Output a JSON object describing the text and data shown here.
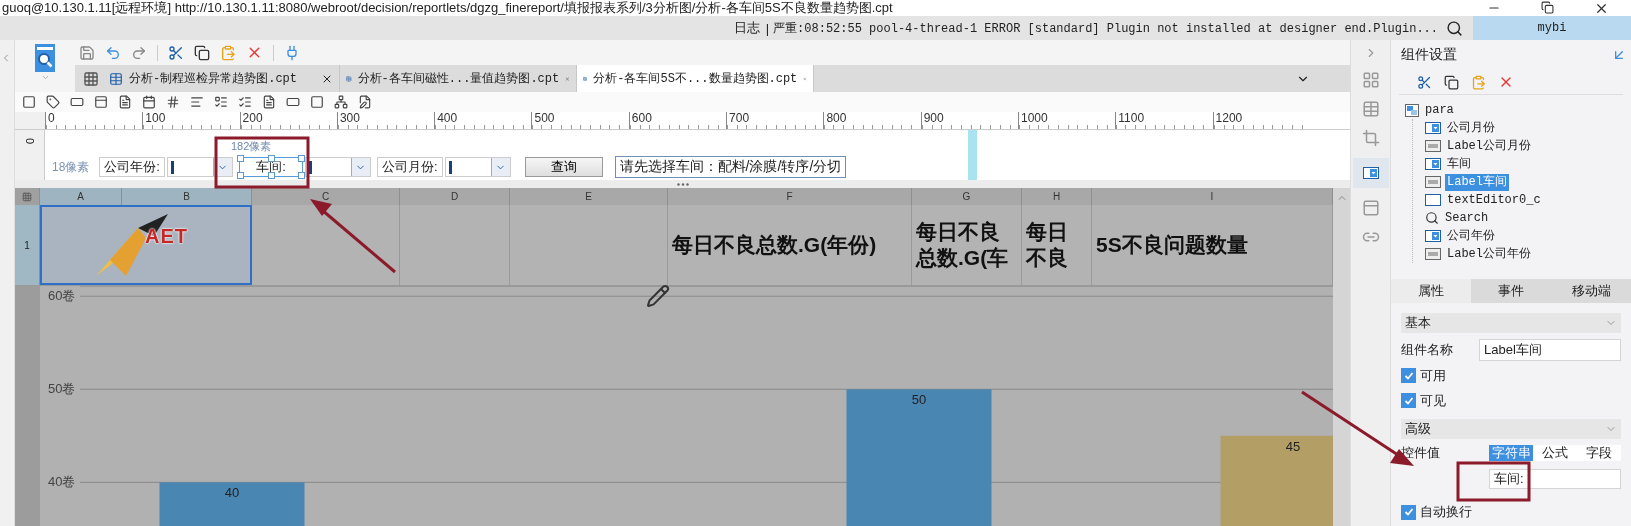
{
  "title_bar": {
    "text": "guoq@10.130.1.11[远程环境]    http://10.130.1.11:8080/webroot/decision/reportlets/dgzg_finereport/填报报表系列/3分析图/分析-各车间5S不良数量趋势图.cpt"
  },
  "log_bar": {
    "label": "日志",
    "separator": "|",
    "message": "严重:08:52:55 pool-4-thread-1 ERROR [standard] Plugin not installed at designer end.Plugin...",
    "user": "mybi"
  },
  "tabs": [
    {
      "label": "分析-制程巡检异常趋势图.cpt",
      "selected": false
    },
    {
      "label": "分析-各车间磁性...量值趋势图.cpt",
      "selected": false
    },
    {
      "label": "分析-各车间5S不...数量趋势图.cpt",
      "selected": true
    }
  ],
  "ruler": {
    "side_mark": "0",
    "marks": [
      "0",
      "100",
      "200",
      "300",
      "400",
      "500",
      "600",
      "700",
      "800",
      "900",
      "1000",
      "1100",
      "1200"
    ]
  },
  "parameter_pane": {
    "height_hint": "18像素",
    "width_hint": "182像素",
    "widgets": [
      {
        "kind": "label",
        "text": "公司年份:",
        "selected": false
      },
      {
        "kind": "combo",
        "selected": false
      },
      {
        "kind": "label",
        "text": "车间:",
        "selected": true
      },
      {
        "kind": "combo",
        "selected": false
      },
      {
        "kind": "label",
        "text": "公司月份:",
        "selected": false
      },
      {
        "kind": "combo",
        "selected": false
      },
      {
        "kind": "button",
        "text": "查询",
        "selected": false
      },
      {
        "kind": "text",
        "text": "请先选择车间：配料/涂膜/转序/分切",
        "selected": false
      }
    ]
  },
  "sheet": {
    "columns": [
      "A",
      "B",
      "C",
      "D",
      "E",
      "F",
      "G",
      "H",
      "I"
    ],
    "rows": [
      {
        "number": "1",
        "cells": [
          {
            "kind": "logo",
            "text": "AET",
            "selected": true
          },
          {
            "kind": "merged",
            "selected": true
          },
          {
            "kind": "empty",
            "selected": false
          },
          {
            "kind": "empty",
            "selected": false
          },
          {
            "kind": "empty",
            "selected": false
          },
          {
            "kind": "title",
            "text": "每日不良总数.G(年份)",
            "selected": false
          },
          {
            "kind": "title",
            "text": "每日不良总数.G(车",
            "selected": false
          },
          {
            "kind": "title",
            "text": "每日不良",
            "selected": false
          },
          {
            "kind": "title",
            "text": "5S不良问题数量",
            "selected": false
          }
        ]
      }
    ]
  },
  "chart": {
    "chart_data": {
      "type": "bar",
      "grid": true,
      "ylim": [
        35.2,
        61.1
      ],
      "yticks": [
        {
          "value": 40,
          "label": "40卷"
        },
        {
          "value": 50,
          "label": "50卷"
        },
        {
          "value": 60,
          "label": "60卷"
        }
      ],
      "data_labels": true,
      "series": [
        {
          "color": "#4a86b2",
          "values": [
            40,
            null,
            null,
            50,
            null
          ]
        },
        {
          "color": "#b39f66",
          "values": [
            null,
            null,
            null,
            null,
            45
          ]
        }
      ]
    }
  },
  "component_settings": {
    "title": "组件设置",
    "tree": {
      "label": "para",
      "children": [
        {
          "kind": "combo",
          "label": "公司月份",
          "selected": false
        },
        {
          "kind": "label",
          "label": "Label公司月份",
          "selected": false
        },
        {
          "kind": "combo",
          "label": "车间",
          "selected": false
        },
        {
          "kind": "label",
          "label": "Label车间",
          "selected": true
        },
        {
          "kind": "text",
          "label": "textEditor0_c",
          "selected": false
        },
        {
          "kind": "search",
          "label": "Search",
          "selected": false
        },
        {
          "kind": "combo",
          "label": "公司年份",
          "selected": false
        },
        {
          "kind": "label",
          "label": "Label公司年份",
          "selected": false
        }
      ]
    },
    "tabs": [
      {
        "label": "属性",
        "selected": true
      },
      {
        "label": "事件",
        "selected": false
      },
      {
        "label": "移动端",
        "selected": false
      }
    ],
    "basic": {
      "title": "基本",
      "name_label": "组件名称",
      "name_value": "Label车间",
      "checks": [
        {
          "label": "可用",
          "checked": true
        },
        {
          "label": "可见",
          "checked": true
        }
      ]
    },
    "advanced": {
      "title": "高级",
      "value_label": "控件值",
      "value_tabs": [
        {
          "label": "字符串",
          "selected": true
        },
        {
          "label": "公式",
          "selected": false
        },
        {
          "label": "字段",
          "selected": false
        }
      ],
      "value": "车间:",
      "checks": [
        {
          "label": "自动换行",
          "checked": true
        }
      ]
    }
  }
}
